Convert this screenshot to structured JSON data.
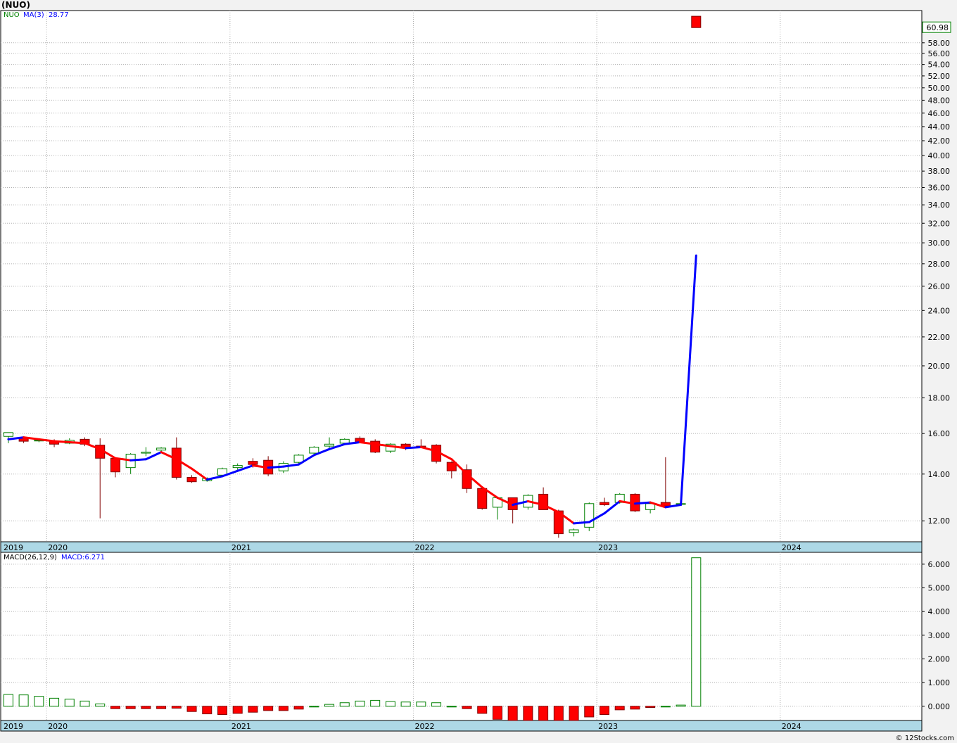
{
  "page": {
    "title": "(NUO)",
    "copyright": "© 12Stocks.com"
  },
  "colors": {
    "up_candle": "#ffffff",
    "down_candle": "#ff0000",
    "outline": "#008000",
    "ma_up": "#0000ff",
    "ma_down": "#ff0000",
    "grid": "#b0b0b0",
    "axis_band": "#add8e6",
    "price_box": "#008000"
  },
  "chart_data": [
    {
      "type": "candlestick",
      "name": "price",
      "legend": {
        "symbol": "NUO",
        "ma_label": "MA(3)",
        "ma_value": "28.77"
      },
      "last_price_label": "60.98",
      "y_scale": "log",
      "ylim": [
        11.2,
        64.5
      ],
      "y_ticks": [
        "12.00",
        "14.00",
        "16.00",
        "18.00",
        "20.00",
        "22.00",
        "24.00",
        "26.00",
        "28.00",
        "30.00",
        "32.00",
        "34.00",
        "36.00",
        "38.00",
        "40.00",
        "42.00",
        "44.00",
        "46.00",
        "48.00",
        "50.00",
        "52.00",
        "54.00",
        "56.00",
        "58.00"
      ],
      "x_labels": [
        "2019",
        "2020",
        "2021",
        "2022",
        "2023",
        "2024"
      ],
      "candles": [
        {
          "d": "2019-10",
          "o": 15.85,
          "h": 16.05,
          "l": 15.5,
          "c": 16.05
        },
        {
          "d": "2019-11",
          "o": 15.8,
          "h": 15.85,
          "l": 15.5,
          "c": 15.6
        },
        {
          "d": "2019-12",
          "o": 15.65,
          "h": 15.75,
          "l": 15.55,
          "c": 15.65
        },
        {
          "d": "2020-01",
          "o": 15.6,
          "h": 15.7,
          "l": 15.3,
          "c": 15.45
        },
        {
          "d": "2020-02",
          "o": 15.5,
          "h": 15.75,
          "l": 15.45,
          "c": 15.65
        },
        {
          "d": "2020-03",
          "o": 15.7,
          "h": 15.8,
          "l": 15.35,
          "c": 15.45
        },
        {
          "d": "2020-04",
          "o": 15.4,
          "h": 15.75,
          "l": 12.1,
          "c": 14.75
        },
        {
          "d": "2020-05",
          "o": 14.75,
          "h": 14.75,
          "l": 13.85,
          "c": 14.1
        },
        {
          "d": "2020-06",
          "o": 14.3,
          "h": 15.0,
          "l": 14.0,
          "c": 14.95
        },
        {
          "d": "2020-07",
          "o": 15.0,
          "h": 15.3,
          "l": 14.85,
          "c": 15.05
        },
        {
          "d": "2020-08",
          "o": 15.15,
          "h": 15.3,
          "l": 15.05,
          "c": 15.25
        },
        {
          "d": "2020-09",
          "o": 15.25,
          "h": 15.8,
          "l": 13.75,
          "c": 13.85
        },
        {
          "d": "2020-10",
          "o": 13.85,
          "h": 13.95,
          "l": 13.6,
          "c": 13.65
        },
        {
          "d": "2020-11",
          "o": 13.7,
          "h": 13.85,
          "l": 13.65,
          "c": 13.8
        },
        {
          "d": "2020-12",
          "o": 13.95,
          "h": 14.3,
          "l": 13.85,
          "c": 14.25
        },
        {
          "d": "2021-01",
          "o": 14.3,
          "h": 14.5,
          "l": 14.2,
          "c": 14.4
        },
        {
          "d": "2021-02",
          "o": 14.6,
          "h": 14.75,
          "l": 14.3,
          "c": 14.45
        },
        {
          "d": "2021-03",
          "o": 14.65,
          "h": 14.85,
          "l": 13.9,
          "c": 14.0
        },
        {
          "d": "2021-04",
          "o": 14.15,
          "h": 14.6,
          "l": 14.05,
          "c": 14.5
        },
        {
          "d": "2021-05",
          "o": 14.55,
          "h": 14.95,
          "l": 14.5,
          "c": 14.9
        },
        {
          "d": "2021-06",
          "o": 15.0,
          "h": 15.35,
          "l": 14.95,
          "c": 15.3
        },
        {
          "d": "2021-07",
          "o": 15.35,
          "h": 15.8,
          "l": 15.2,
          "c": 15.45
        },
        {
          "d": "2021-08",
          "o": 15.5,
          "h": 15.75,
          "l": 15.45,
          "c": 15.7
        },
        {
          "d": "2021-09",
          "o": 15.75,
          "h": 15.85,
          "l": 15.5,
          "c": 15.55
        },
        {
          "d": "2021-10",
          "o": 15.6,
          "h": 15.7,
          "l": 15.0,
          "c": 15.05
        },
        {
          "d": "2021-11",
          "o": 15.1,
          "h": 15.5,
          "l": 15.0,
          "c": 15.45
        },
        {
          "d": "2021-12",
          "o": 15.45,
          "h": 15.5,
          "l": 15.15,
          "c": 15.25
        },
        {
          "d": "2022-01",
          "o": 15.35,
          "h": 15.7,
          "l": 15.25,
          "c": 15.3
        },
        {
          "d": "2022-02",
          "o": 15.4,
          "h": 15.45,
          "l": 14.5,
          "c": 14.6
        },
        {
          "d": "2022-03",
          "o": 14.55,
          "h": 14.6,
          "l": 13.8,
          "c": 14.15
        },
        {
          "d": "2022-04",
          "o": 14.2,
          "h": 14.45,
          "l": 13.15,
          "c": 13.35
        },
        {
          "d": "2022-05",
          "o": 13.35,
          "h": 13.4,
          "l": 12.45,
          "c": 12.5
        },
        {
          "d": "2022-06",
          "o": 12.55,
          "h": 12.95,
          "l": 12.05,
          "c": 12.95
        },
        {
          "d": "2022-07",
          "o": 12.95,
          "h": 12.95,
          "l": 11.9,
          "c": 12.45
        },
        {
          "d": "2022-08",
          "o": 12.55,
          "h": 13.1,
          "l": 12.45,
          "c": 13.05
        },
        {
          "d": "2022-09",
          "o": 13.1,
          "h": 13.4,
          "l": 12.45,
          "c": 12.45
        },
        {
          "d": "2022-10",
          "o": 12.4,
          "h": 12.45,
          "l": 11.35,
          "c": 11.5
        },
        {
          "d": "2022-11",
          "o": 11.55,
          "h": 11.7,
          "l": 11.4,
          "c": 11.65
        },
        {
          "d": "2022-12",
          "o": 11.75,
          "h": 12.75,
          "l": 11.6,
          "c": 12.7
        },
        {
          "d": "2023-01",
          "o": 12.75,
          "h": 12.95,
          "l": 12.6,
          "c": 12.65
        },
        {
          "d": "2023-02",
          "o": 12.75,
          "h": 13.15,
          "l": 12.7,
          "c": 13.1
        },
        {
          "d": "2023-03",
          "o": 13.1,
          "h": 13.15,
          "l": 12.35,
          "c": 12.4
        },
        {
          "d": "2023-04",
          "o": 12.45,
          "h": 12.75,
          "l": 12.3,
          "c": 12.7
        },
        {
          "d": "2023-05",
          "o": 12.75,
          "h": 14.8,
          "l": 12.55,
          "c": 12.6
        },
        {
          "d": "2023-06",
          "o": 12.68,
          "h": 12.72,
          "l": 12.65,
          "c": 12.7
        },
        {
          "d": "2023-07",
          "o": 63.3,
          "h": 63.3,
          "l": 60.98,
          "c": 60.98
        }
      ],
      "ma": [
        15.7,
        15.8,
        15.7,
        15.6,
        15.55,
        15.5,
        15.2,
        14.75,
        14.65,
        14.7,
        15.05,
        14.7,
        14.25,
        13.75,
        13.9,
        14.15,
        14.4,
        14.3,
        14.35,
        14.45,
        14.9,
        15.2,
        15.45,
        15.55,
        15.45,
        15.35,
        15.25,
        15.3,
        15.1,
        14.7,
        14.0,
        13.4,
        12.95,
        12.65,
        12.8,
        12.65,
        12.35,
        11.9,
        11.95,
        12.3,
        12.8,
        12.7,
        12.75,
        12.55,
        12.65,
        28.77
      ]
    },
    {
      "type": "bar",
      "name": "macd",
      "legend": {
        "label": "MACD(26,12,9)",
        "value_label": "MACD:6.271"
      },
      "ylim": [
        -0.6,
        6.5
      ],
      "y_ticks": [
        "0.000",
        "1.000",
        "2.000",
        "3.000",
        "4.000",
        "5.000",
        "6.000"
      ],
      "x_labels": [
        "2019",
        "2020",
        "2021",
        "2022",
        "2023",
        "2024"
      ],
      "values": [
        0.5,
        0.48,
        0.42,
        0.34,
        0.3,
        0.22,
        0.1,
        -0.1,
        -0.1,
        -0.1,
        -0.1,
        -0.08,
        -0.22,
        -0.32,
        -0.35,
        -0.3,
        -0.25,
        -0.18,
        -0.18,
        -0.12,
        0.0,
        0.08,
        0.15,
        0.22,
        0.25,
        0.2,
        0.18,
        0.18,
        0.15,
        0.0,
        -0.1,
        -0.3,
        -0.55,
        -0.6,
        -0.6,
        -0.6,
        -0.6,
        -0.6,
        -0.45,
        -0.35,
        -0.15,
        -0.12,
        -0.05,
        0.0,
        0.05,
        6.271
      ]
    }
  ]
}
